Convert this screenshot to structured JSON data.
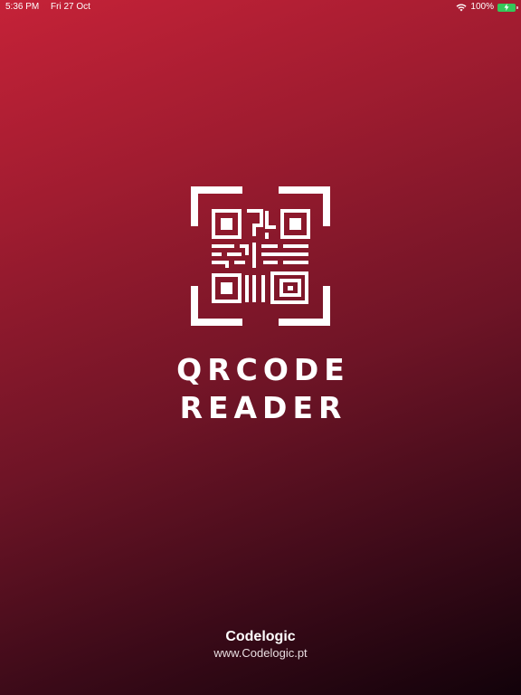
{
  "status_bar": {
    "time": "5:36 PM",
    "date": "Fri 27 Oct",
    "battery": "100%",
    "wifi_icon": "wifi-icon",
    "battery_icon": "battery-charging-icon"
  },
  "splash": {
    "logo_icon": "qr-code-icon",
    "title_line1": "QRCODE",
    "title_line2": "READER"
  },
  "footer": {
    "company": "Codelogic",
    "url": "www.Codelogic.pt"
  },
  "colors": {
    "gradient_top": "#c52238",
    "gradient_bottom": "#12020a",
    "battery": "#35c759",
    "text": "#ffffff"
  }
}
